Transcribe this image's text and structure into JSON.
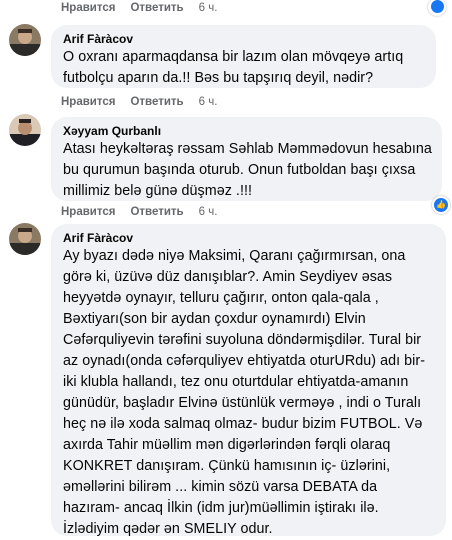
{
  "colors": {
    "bubble": "#f0f2f5",
    "muted_text": "#65676b",
    "like_blue": "#1877f2",
    "reaction_yellow": "#f7b928"
  },
  "top_actions": {
    "like": "Нравится",
    "reply": "Ответить",
    "time": "6 ч."
  },
  "comments": [
    {
      "author": "Arif Fàràcov",
      "lines": [
        "O oxranı aparmaqdansa bir lazım olan mövqeyə artıq",
        "futbolçu aparın da.!! Bəs bu tapşırıq deyil, nədir?"
      ],
      "like": "Нравится",
      "reply": "Ответить",
      "time": "6 ч.",
      "reaction_icon": "none"
    },
    {
      "author": "Xəyyam Qurbanlı",
      "lines": [
        "Atası heykəltəraş rəssam Səhlab Məmmədovun hesabına",
        "bu qurumun başında oturub. Onun futboldan başı çıxsa",
        "millimiz belə günə düşməz .!!!"
      ],
      "like": "Нравится",
      "reply": "Ответить",
      "time": "6 ч.",
      "reaction_icon": "like-icon"
    },
    {
      "author": "Arif Fàràcov",
      "lines": [
        "Ay byazı dədə niyə Maksimi, Qaranı çağırmırsan, ona",
        "görə ki, üzüvə düz danışıblar?. Amin Seydiyev əsas",
        "heyyətdə oynayır, telluru çağırır, onton qala-qala ,",
        "Bəxtiyarı(son bir aydan çoxdur oynamırdı) Elvin",
        "Cəfərquliyevin tərəfini suyoluna döndərmişdilər. Tural bir",
        "az oynadı(onda cəfərquliyev ehtiyatda oturURdu) adı bir-",
        "iki klubla hallandı, tez onu oturtdular ehtiyatda-amanın",
        "günüdür, başladır Elvinə üstünlük verməyə , indi o Turalı",
        "heç nə ilə xoda salmaq olmaz- budur bizim FUTBOL. Və",
        "axırda Tahir müəllim mən digərlərindən fərqli olaraq",
        "KONKRET danışıram. Çünkü hamısının iç- üzlərini,",
        "əməllərini bilirəm ... kimin sözü varsa DEBATA da",
        "hazıram- ancaq İlkin (idm jur)müəllimin iştirakı ilə.",
        "İzlədiyim qədər ən SMELIY odur."
      ]
    }
  ]
}
